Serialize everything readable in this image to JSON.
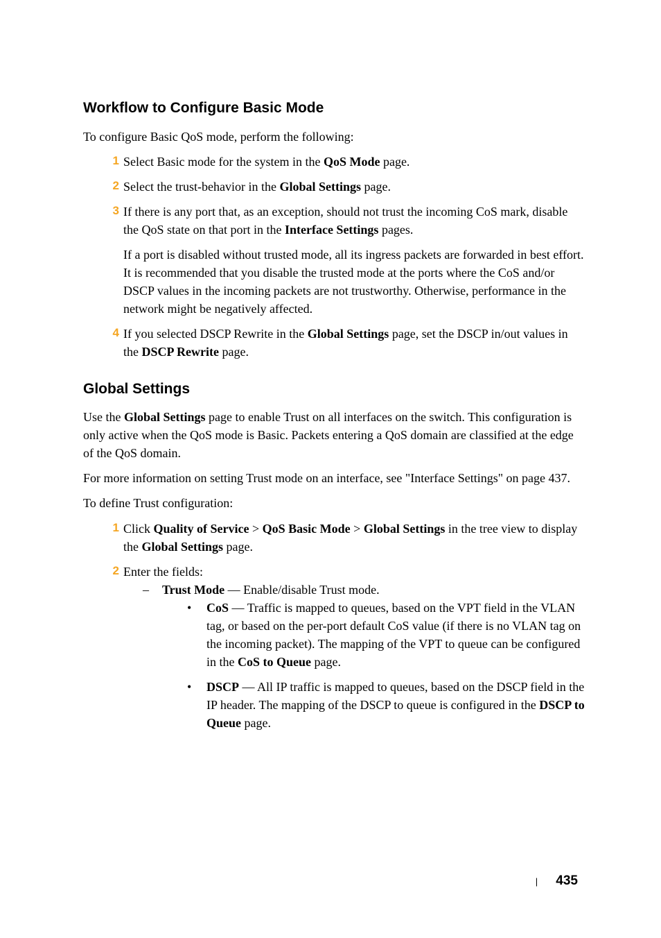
{
  "section1": {
    "heading": "Workflow to Configure Basic Mode",
    "intro": "To configure Basic QoS mode, perform the following:",
    "items": [
      {
        "num": "1",
        "text_before": "Select Basic mode for the system in the ",
        "bold1": "QoS Mode",
        "text_after": " page."
      },
      {
        "num": "2",
        "text_before": "Select the trust-behavior in the ",
        "bold1": "Global Settings",
        "text_after": " page."
      },
      {
        "num": "3",
        "text_before": "If there is any port that, as an exception, should not trust the incoming CoS mark, disable the QoS state on that port in the ",
        "bold1": "Interface Settings",
        "text_after": " pages.",
        "sub_para": "If a port is disabled without trusted mode, all its ingress packets are forwarded in best effort. It is recommended that you disable the trusted mode at the ports where the CoS and/or DSCP values in the incoming packets are not trustworthy. Otherwise, performance in the network might be negatively affected."
      },
      {
        "num": "4",
        "text_before": "If you selected DSCP Rewrite in the ",
        "bold1": "Global Settings",
        "text_mid": " page, set the DSCP in/out values in the ",
        "bold2": "DSCP Rewrite",
        "text_after": " page."
      }
    ]
  },
  "section2": {
    "heading": "Global Settings",
    "para1_before": "Use the ",
    "para1_bold": "Global Settings",
    "para1_after": " page to enable Trust on all interfaces on the switch. This configuration is only active when the QoS mode is Basic. Packets entering a QoS domain are classified at the edge of the QoS domain.",
    "para2": "For more information on setting Trust mode on an interface, see \"Interface Settings\" on page 437.",
    "para3": "To define Trust configuration:",
    "items": [
      {
        "num": "1",
        "text_before": "Click ",
        "bold1": "Quality of Service",
        "text_mid1": " > ",
        "bold2": "QoS Basic Mode",
        "text_mid2": " > ",
        "bold3": "Global Settings",
        "text_mid3": " in the tree view to display the ",
        "bold4": "Global Settings",
        "text_after": " page."
      },
      {
        "num": "2",
        "text": "Enter the fields:"
      }
    ],
    "dash_item": {
      "bold": "Trust Mode",
      "text": " — Enable/disable Trust mode."
    },
    "bullets": [
      {
        "bold": "CoS",
        "text_before": " — Traffic is mapped to queues, based on the VPT field in the VLAN tag, or based on the per-port default CoS value (if there is no VLAN tag on the incoming packet). The mapping of the VPT to queue can be configured in the ",
        "bold_end": "CoS to Queue",
        "text_after": " page."
      },
      {
        "bold": "DSCP",
        "text_before": " — All IP traffic is mapped to queues, based on the DSCP field in the IP header. The mapping of the DSCP to queue is configured in the ",
        "bold_end": "DSCP to Queue",
        "text_after": " page."
      }
    ]
  },
  "footer": {
    "page": "435"
  }
}
